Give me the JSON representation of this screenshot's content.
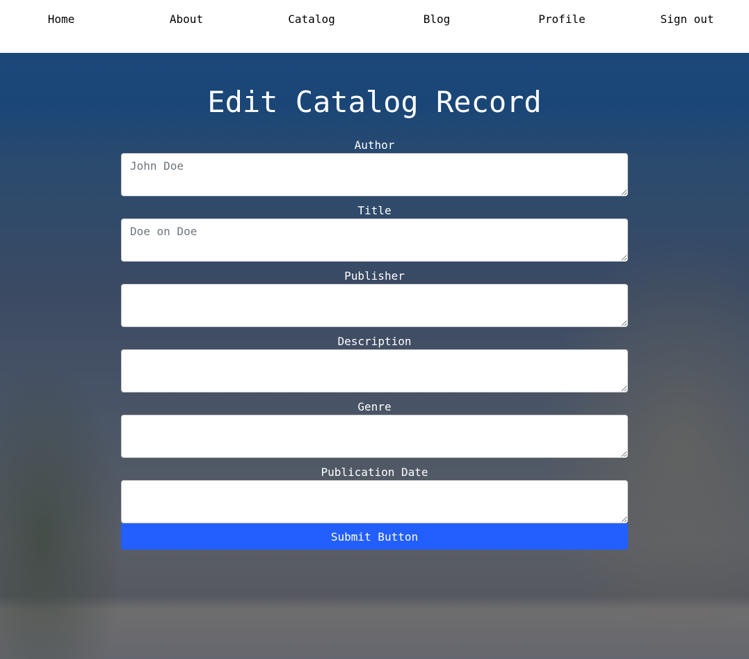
{
  "nav": {
    "items": [
      "Home",
      "About",
      "Catalog",
      "Blog",
      "Profile",
      "Sign out"
    ]
  },
  "page_title": "Edit Catalog Record",
  "form": {
    "fields": [
      {
        "label": "Author",
        "placeholder": "John Doe",
        "value": ""
      },
      {
        "label": "Title",
        "placeholder": "Doe on Doe",
        "value": ""
      },
      {
        "label": "Publisher",
        "placeholder": "",
        "value": ""
      },
      {
        "label": "Description",
        "placeholder": "",
        "value": ""
      },
      {
        "label": "Genre",
        "placeholder": "",
        "value": ""
      },
      {
        "label": "Publication Date",
        "placeholder": "",
        "value": ""
      }
    ],
    "submit_label": "Submit Button"
  },
  "colors": {
    "accent": "#235fff",
    "nav_bg": "#ffffff"
  }
}
